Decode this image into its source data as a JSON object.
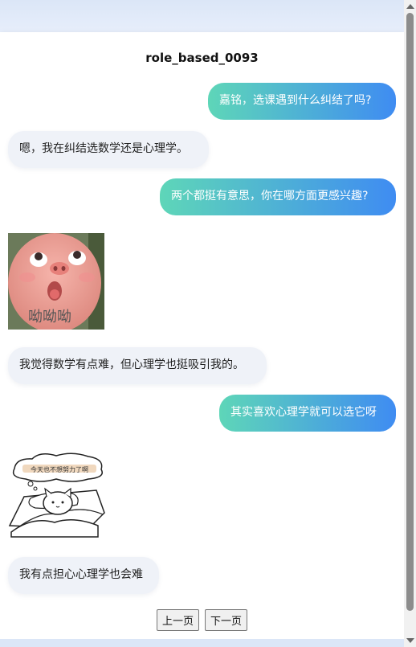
{
  "page": {
    "title": "role_based_0093"
  },
  "messages": [
    {
      "side": "me",
      "text": "嘉铭，选课遇到什么纠结了吗?"
    },
    {
      "side": "other",
      "text": "嗯，我在纠结选数学还是心理学。"
    },
    {
      "side": "me",
      "text": "两个都挺有意思，你在哪方面更感兴趣?"
    },
    {
      "side": "other",
      "type": "sticker",
      "sticker": "pig-face-sticker",
      "caption": "呦呦呦"
    },
    {
      "side": "other",
      "text": "我觉得数学有点难，但心理学也挺吸引我的。"
    },
    {
      "side": "me",
      "text": "其实喜欢心理学就可以选它呀"
    },
    {
      "side": "other",
      "type": "sticker",
      "sticker": "sleeping-cat-sticker",
      "caption": "今天也不想努力了啊"
    },
    {
      "side": "other",
      "text": "我有点担心心理学也会难"
    }
  ],
  "pager": {
    "prev_label": "上一页",
    "next_label": "下一页"
  },
  "colors": {
    "me_gradient_start": "#5ed6b8",
    "me_gradient_end": "#3f8cf2",
    "other_bubble": "#eff2f8"
  }
}
